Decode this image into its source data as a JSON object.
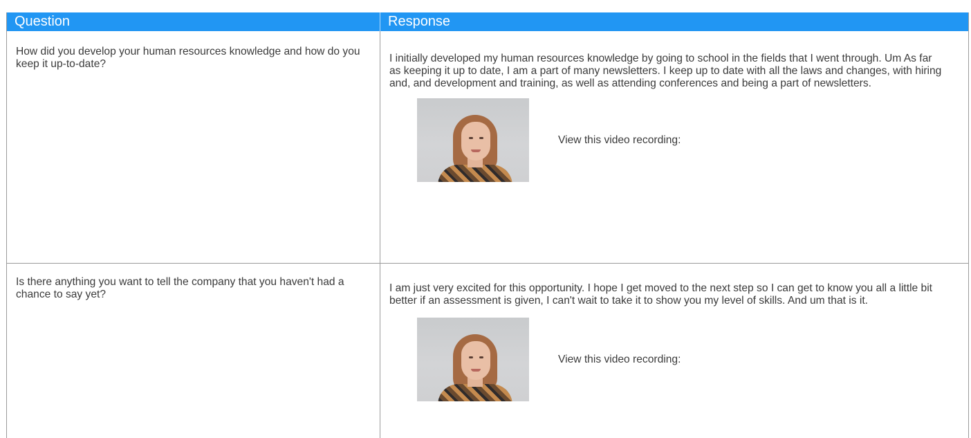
{
  "table": {
    "headers": {
      "question": "Question",
      "response": "Response"
    },
    "rows": [
      {
        "question": "How did you develop your human resources knowledge and how do you keep it up-to-date?",
        "response": "I initially developed my human resources knowledge by going to school in the fields that I went through. Um As far as keeping it up to date, I am a part of many newsletters. I keep up to date with all the laws and changes, with hiring and, and development and training, as well as attending conferences and being a part of newsletters.",
        "video_label": "View this video recording:",
        "thumbnail_icon": "video-thumbnail-icon"
      },
      {
        "question": "Is there anything you want to tell the company that you haven't had a chance to say yet?",
        "response": "I am just very excited for this opportunity. I hope I get moved to the next step so I can get to know you all a little bit better if an assessment is given, I can't wait to take it to show you my level of skills. And um that is it.",
        "video_label": "View this video recording:",
        "thumbnail_icon": "video-thumbnail-icon"
      }
    ]
  },
  "colors": {
    "header_bg": "#2196f3",
    "header_text": "#ffffff",
    "border": "#9a9a9a",
    "body_text": "#3a3a3a"
  }
}
